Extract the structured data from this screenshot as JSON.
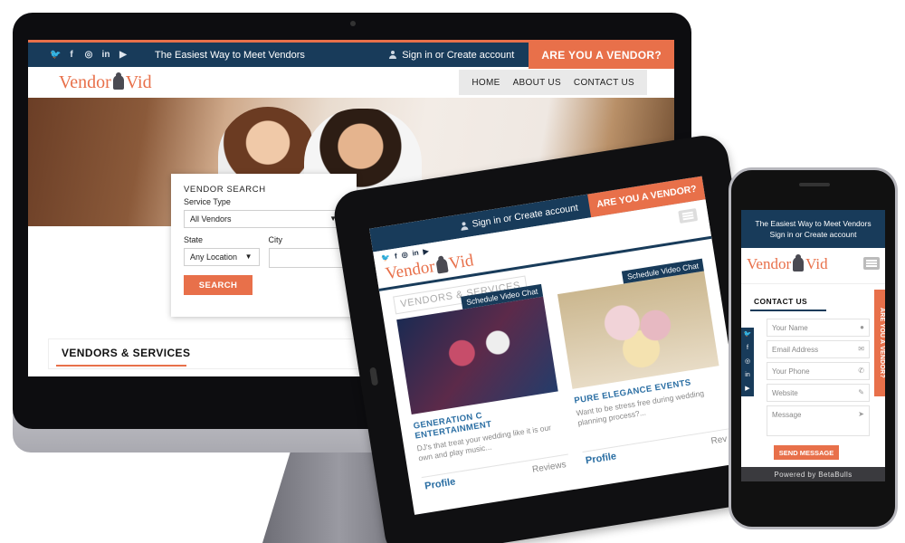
{
  "desktop": {
    "social_icons": [
      "twitter-icon",
      "facebook-icon",
      "instagram-icon",
      "linkedin-icon",
      "youtube-icon"
    ],
    "social_glyphs": [
      "🐦",
      "f",
      "◎",
      "in",
      "▶"
    ],
    "tagline": "The Easiest Way to Meet Vendors",
    "signin": "Sign in or Create account",
    "vendor_cta": "ARE YOU A VENDOR?",
    "logo_left": "Vendor",
    "logo_right": "Vid",
    "nav": [
      "HOME",
      "ABOUT US",
      "CONTACT US"
    ],
    "search": {
      "title": "VENDOR SEARCH",
      "service_label": "Service Type",
      "service_value": "All Vendors",
      "state_label": "State",
      "state_value": "Any Location",
      "city_label": "City",
      "button": "SEARCH"
    },
    "section_title": "VENDORS & SERVICES"
  },
  "tablet": {
    "signin": "Sign in or Create account",
    "vendor_cta": "ARE YOU A VENDOR?",
    "logo_left": "Vendor",
    "logo_right": "Vid",
    "section_title": "VENDORS & SERVICES",
    "cards": [
      {
        "tag": "Schedule Video Chat",
        "name": "GENERATION C ENTERTAINMENT",
        "desc": "DJ's that treat your wedding like it is our own and play music...",
        "profile": "Profile",
        "reviews": "Reviews"
      },
      {
        "tag": "Schedule Video Chat",
        "name": "PURE ELEGANCE EVENTS",
        "desc": "Want to be stress free during wedding planning process?...",
        "profile": "Profile",
        "reviews": "Rev"
      }
    ]
  },
  "phone": {
    "tagline": "The Easiest Way to Meet Vendors",
    "signin": "Sign in or Create account",
    "logo_left": "Vendor",
    "logo_right": "Vid",
    "contact_title": "CONTACT US",
    "vendor_tab": "ARE YOU A VENDOR?",
    "fields": [
      {
        "placeholder": "Your Name",
        "icon": "user-icon"
      },
      {
        "placeholder": "Email Address",
        "icon": "mail-icon"
      },
      {
        "placeholder": "Your Phone",
        "icon": "phone-icon"
      },
      {
        "placeholder": "Website",
        "icon": "pencil-icon"
      },
      {
        "placeholder": "Message",
        "icon": "send-icon"
      }
    ],
    "send_button": "SEND MESSAGE",
    "footer": "Powered by BetaBulls"
  },
  "colors": {
    "navy": "#183b5a",
    "accent": "#e8704a"
  }
}
